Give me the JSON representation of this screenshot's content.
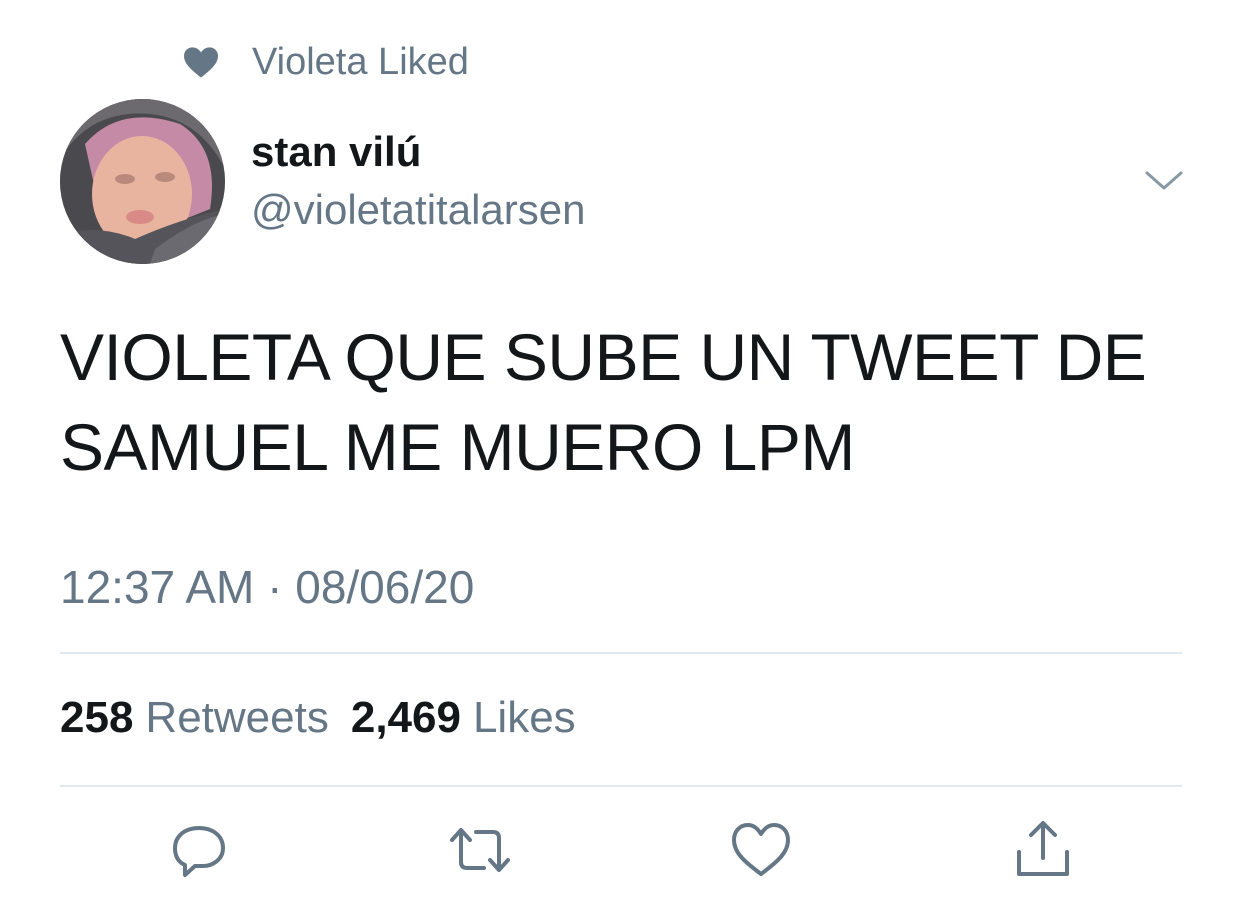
{
  "social_context": {
    "icon": "heart-icon",
    "text": "Violeta Liked"
  },
  "author": {
    "display_name": "stan vilú",
    "handle": "@violetatitalarsen"
  },
  "tweet": {
    "text": "VIOLETA QUE SUBE UN TWEET DE SAMUEL ME MUERO LPM"
  },
  "timestamp": "12:37 AM · 08/06/20",
  "stats": {
    "retweets_count": "258",
    "retweets_label": "Retweets",
    "likes_count": "2,469",
    "likes_label": "Likes"
  },
  "actions": [
    {
      "name": "reply",
      "icon": "reply-icon"
    },
    {
      "name": "retweet",
      "icon": "retweet-icon"
    },
    {
      "name": "like",
      "icon": "heart-outline-icon"
    },
    {
      "name": "share",
      "icon": "share-icon"
    }
  ],
  "colors": {
    "text": "#14171a",
    "secondary": "#657786",
    "divider": "#e1e8ed"
  }
}
